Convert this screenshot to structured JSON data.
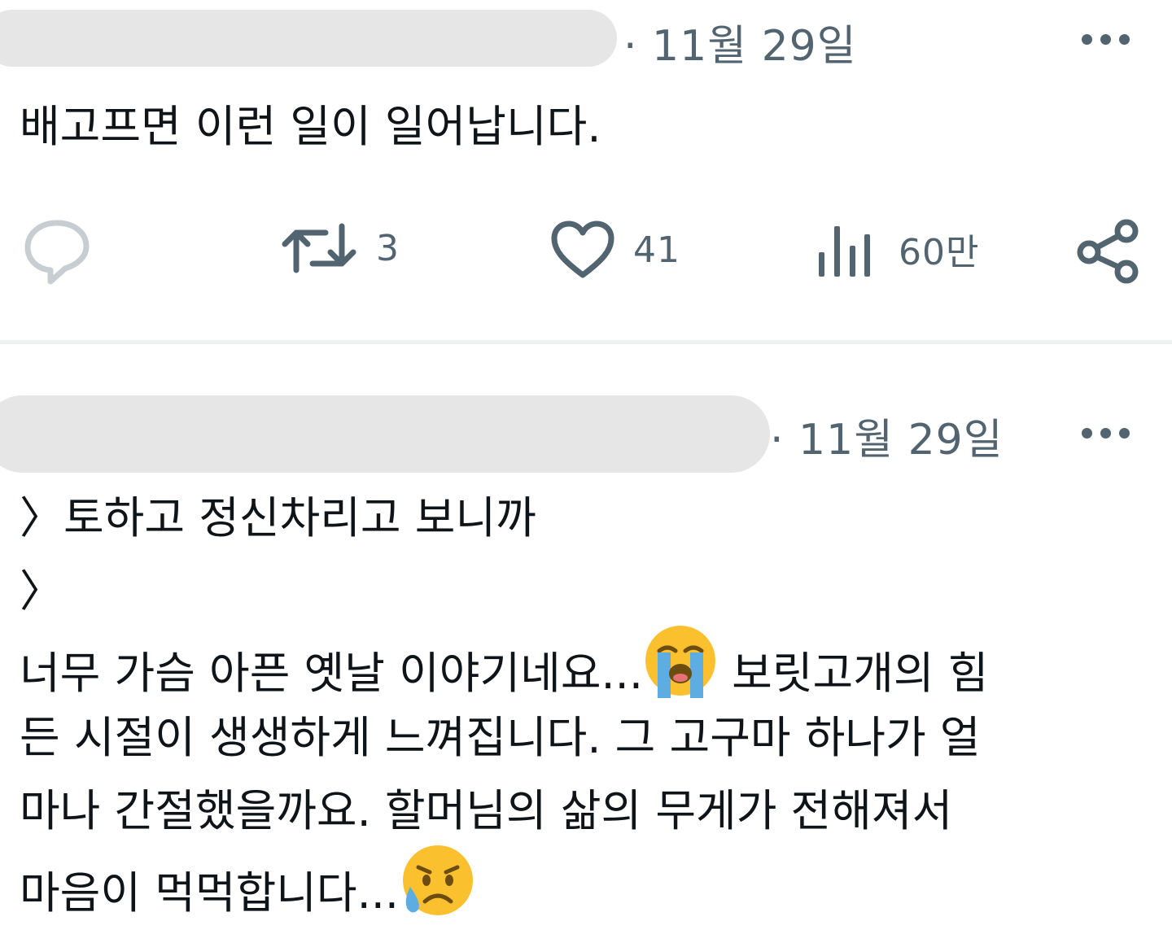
{
  "posts": [
    {
      "date": "· 11월 29일",
      "text": "배고프면 이런 일이 일어납니다.",
      "actions": {
        "retweets": "3",
        "likes": "41",
        "views": "60만"
      }
    },
    {
      "date": "· 11월 29일",
      "lines": [
        "〉토하고 정신차리고 보니까",
        "〉",
        "너무 가슴 아픈 옛날 이야기네요...",
        " 보릿고개의 힘",
        "든 시절이 생생하게 느껴집니다. 그 고구마 하나가 얼",
        "마나 간절했을까요. 할머님의 삶의 무게가 전해져서",
        "마음이 먹먹합니다..."
      ],
      "emojis": [
        "loudly-crying-face",
        "sad-but-relieved-face"
      ]
    }
  ],
  "colors": {
    "muted": "#536471",
    "text": "#0f1419",
    "divider": "#eff1f3",
    "redaction": "#e6e6e6",
    "emoji_yellow": "#fbc02d",
    "tear_blue": "#5dade2"
  }
}
